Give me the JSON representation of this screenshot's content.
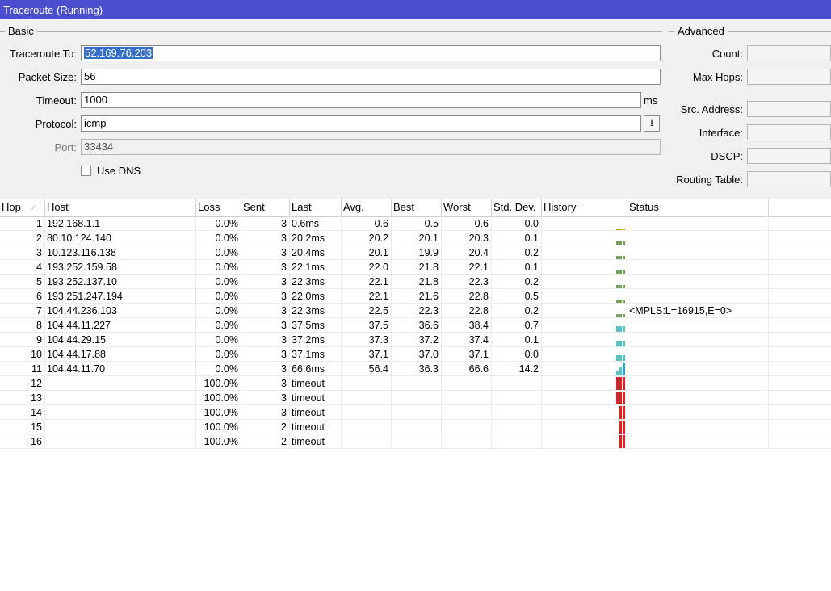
{
  "window": {
    "title": "Traceroute (Running)"
  },
  "sections": {
    "basic": "Basic",
    "advanced": "Advanced"
  },
  "form": {
    "traceroute_to_label": "Traceroute To:",
    "traceroute_to_value": "52.169.76.203",
    "packet_size_label": "Packet Size:",
    "packet_size_value": "56",
    "timeout_label": "Timeout:",
    "timeout_value": "1000",
    "timeout_unit": "ms",
    "protocol_label": "Protocol:",
    "protocol_value": "icmp",
    "port_label": "Port:",
    "port_value": "33434",
    "use_dns_label": "Use DNS",
    "use_dns_checked": false
  },
  "advanced": {
    "count_label": "Count:",
    "max_hops_label": "Max Hops:",
    "src_address_label": "Src. Address:",
    "interface_label": "Interface:",
    "dscp_label": "DSCP:",
    "routing_table_label": "Routing Table:"
  },
  "table": {
    "columns": [
      "Hop",
      "Host",
      "Loss",
      "Sent",
      "Last",
      "Avg.",
      "Best",
      "Worst",
      "Std. Dev.",
      "History",
      "Status"
    ],
    "rows": [
      {
        "hop": "1",
        "host": "192.168.1.1",
        "loss": "0.0%",
        "sent": "3",
        "last": "0.6ms",
        "avg": "0.6",
        "best": "0.5",
        "worst": "0.6",
        "std": "0.0",
        "status": "",
        "history": "tiny"
      },
      {
        "hop": "2",
        "host": "80.10.124.140",
        "loss": "0.0%",
        "sent": "3",
        "last": "20.2ms",
        "avg": "20.2",
        "best": "20.1",
        "worst": "20.3",
        "std": "0.1",
        "status": "",
        "history": "small"
      },
      {
        "hop": "3",
        "host": "10.123.116.138",
        "loss": "0.0%",
        "sent": "3",
        "last": "20.4ms",
        "avg": "20.1",
        "best": "19.9",
        "worst": "20.4",
        "std": "0.2",
        "status": "",
        "history": "small"
      },
      {
        "hop": "4",
        "host": "193.252.159.58",
        "loss": "0.0%",
        "sent": "3",
        "last": "22.1ms",
        "avg": "22.0",
        "best": "21.8",
        "worst": "22.1",
        "std": "0.1",
        "status": "",
        "history": "small"
      },
      {
        "hop": "5",
        "host": "193.252.137.10",
        "loss": "0.0%",
        "sent": "3",
        "last": "22.3ms",
        "avg": "22.1",
        "best": "21.8",
        "worst": "22.3",
        "std": "0.2",
        "status": "",
        "history": "small"
      },
      {
        "hop": "6",
        "host": "193.251.247.194",
        "loss": "0.0%",
        "sent": "3",
        "last": "22.0ms",
        "avg": "22.1",
        "best": "21.6",
        "worst": "22.8",
        "std": "0.5",
        "status": "",
        "history": "small"
      },
      {
        "hop": "7",
        "host": "104.44.236.103",
        "loss": "0.0%",
        "sent": "3",
        "last": "22.3ms",
        "avg": "22.5",
        "best": "22.3",
        "worst": "22.8",
        "std": "0.2",
        "status": "<MPLS:L=16915,E=0>",
        "history": "small"
      },
      {
        "hop": "8",
        "host": "104.44.11.227",
        "loss": "0.0%",
        "sent": "3",
        "last": "37.5ms",
        "avg": "37.5",
        "best": "36.6",
        "worst": "38.4",
        "std": "0.7",
        "status": "",
        "history": "medium"
      },
      {
        "hop": "9",
        "host": "104.44.29.15",
        "loss": "0.0%",
        "sent": "3",
        "last": "37.2ms",
        "avg": "37.3",
        "best": "37.2",
        "worst": "37.4",
        "std": "0.1",
        "status": "",
        "history": "medium"
      },
      {
        "hop": "10",
        "host": "104.44.17.88",
        "loss": "0.0%",
        "sent": "3",
        "last": "37.1ms",
        "avg": "37.1",
        "best": "37.0",
        "worst": "37.1",
        "std": "0.0",
        "status": "",
        "history": "medium"
      },
      {
        "hop": "11",
        "host": "104.44.11.70",
        "loss": "0.0%",
        "sent": "3",
        "last": "66.6ms",
        "avg": "56.4",
        "best": "36.3",
        "worst": "66.6",
        "std": "14.2",
        "status": "",
        "history": "large"
      },
      {
        "hop": "12",
        "host": "",
        "loss": "100.0%",
        "sent": "3",
        "last": "timeout",
        "avg": "",
        "best": "",
        "worst": "",
        "std": "",
        "status": "",
        "history": "timeout3"
      },
      {
        "hop": "13",
        "host": "",
        "loss": "100.0%",
        "sent": "3",
        "last": "timeout",
        "avg": "",
        "best": "",
        "worst": "",
        "std": "",
        "status": "",
        "history": "timeout3"
      },
      {
        "hop": "14",
        "host": "",
        "loss": "100.0%",
        "sent": "3",
        "last": "timeout",
        "avg": "",
        "best": "",
        "worst": "",
        "std": "",
        "status": "",
        "history": "timeout2"
      },
      {
        "hop": "15",
        "host": "",
        "loss": "100.0%",
        "sent": "2",
        "last": "timeout",
        "avg": "",
        "best": "",
        "worst": "",
        "std": "",
        "status": "",
        "history": "timeout2"
      },
      {
        "hop": "16",
        "host": "",
        "loss": "100.0%",
        "sent": "2",
        "last": "timeout",
        "avg": "",
        "best": "",
        "worst": "",
        "std": "",
        "status": "",
        "history": "timeout2"
      }
    ]
  },
  "colors": {
    "title_bar": "#4a4fd0",
    "history_green": "#6aa84f",
    "history_teal": "#4fc3c8",
    "history_blue": "#2a9fd6",
    "history_red": "#e02020",
    "history_yellow": "#c8a000"
  }
}
